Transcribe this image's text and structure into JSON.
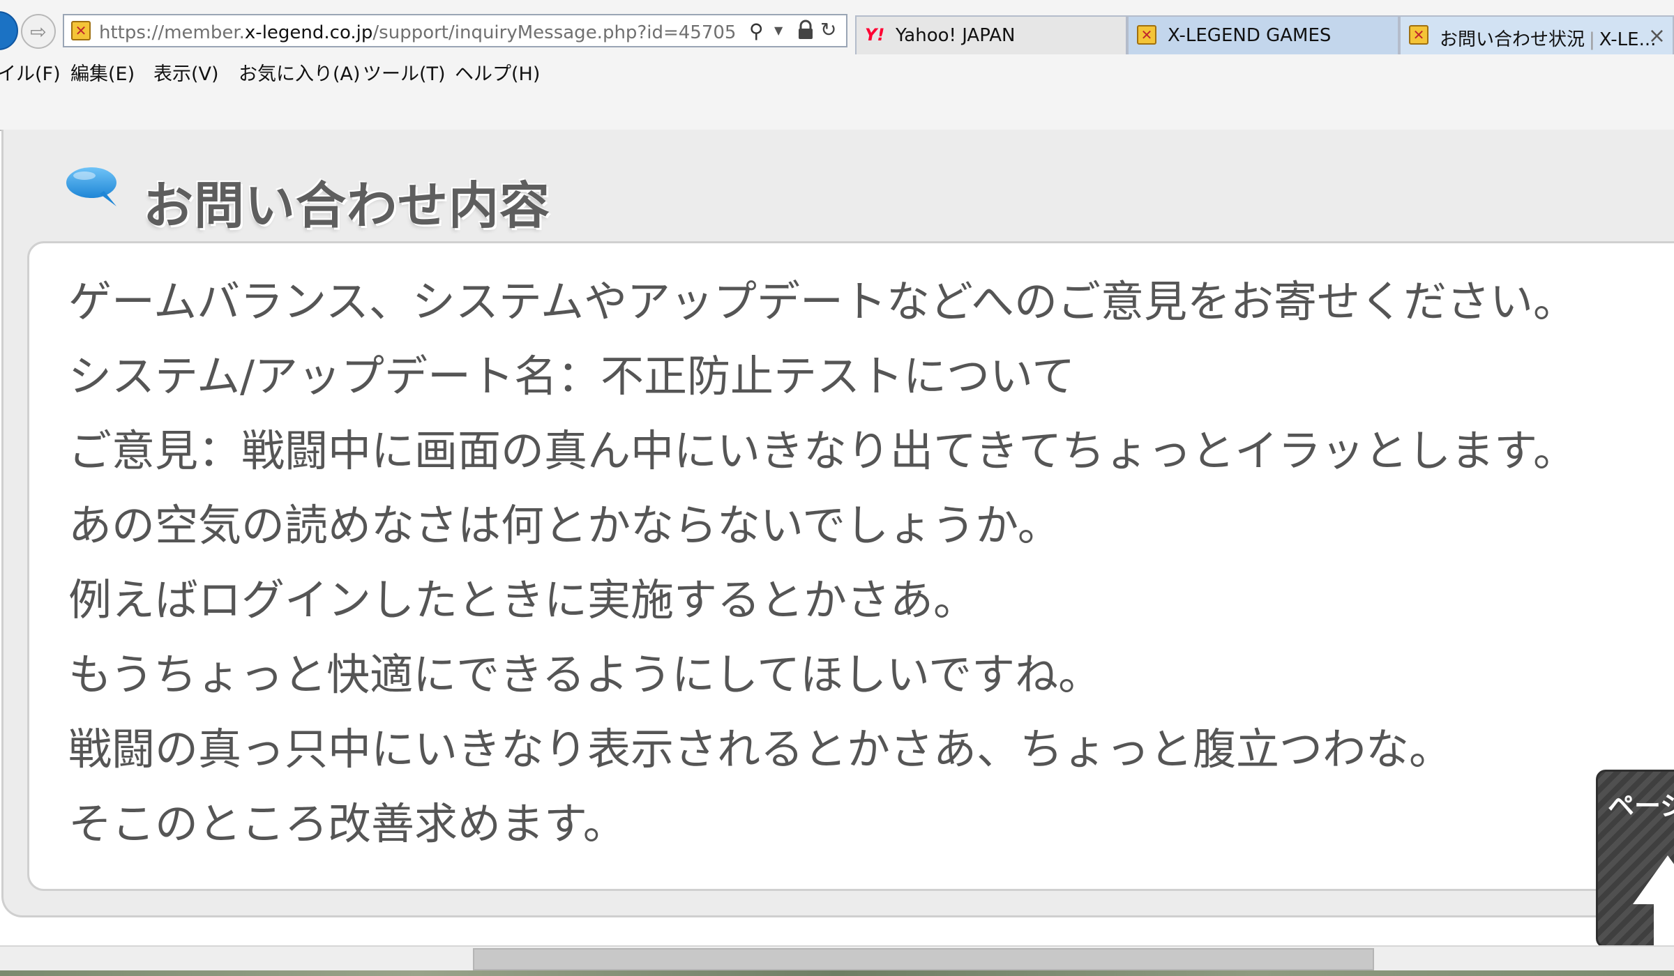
{
  "browser": {
    "address": {
      "prefix": "https://member.",
      "host": "x-legend.co.jp",
      "path": "/support/inquiryMessage.php?id=45705"
    },
    "tabs": [
      {
        "label": "Yahoo! JAPAN",
        "icon": "yahoo-icon"
      },
      {
        "label": "X-LEGEND GAMES",
        "icon": "x-legend-favicon"
      },
      {
        "label": "お問い合わせ状況",
        "separator": "|",
        "label_rest": "X-LE...",
        "icon": "x-legend-favicon",
        "active": true
      }
    ],
    "menu": [
      "イル(F)",
      "編集(E)",
      "表示(V)",
      "お気に入り(A)",
      "ツール(T)",
      "ヘルプ(H)"
    ]
  },
  "section": {
    "title": "お問い合わせ内容",
    "icon": "speech-bubble-icon"
  },
  "message": {
    "lines": [
      "ゲームバランス、システムやアップデートなどへのご意見をお寄せください。",
      "システム/アップデート名：不正防止テストについて",
      "ご意見：戦闘中に画面の真ん中にいきなり出てきてちょっとイラッとします。",
      "あの空気の読めなさは何とかならないでしょうか。",
      "例えばログインしたときに実施するとかさあ。",
      "もうちょっと快適にできるようにしてほしいですね。",
      "戦闘の真っ只中にいきなり表示されるとかさあ、ちょっと腹立つわな。",
      "そこのところ改善求めます。"
    ]
  },
  "page_top_button": {
    "label": "ページ"
  },
  "colors": {
    "accent_blue": "#1b72c4",
    "panel_bg": "#ececec",
    "title_gray": "#5e5e5e",
    "body_text": "#555555"
  }
}
